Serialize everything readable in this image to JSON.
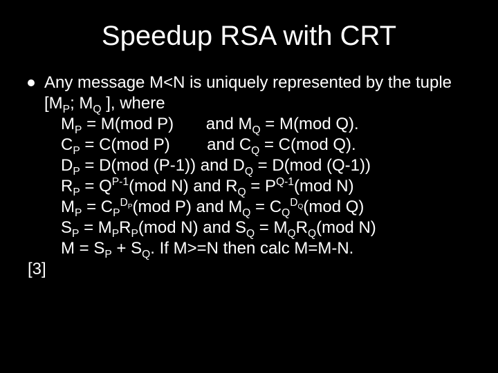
{
  "title": "Speedup RSA with CRT",
  "intro": "Any message M<N is uniquely represented by the tuple [M",
  "intro_sub1": "P",
  "intro_mid": "; M",
  "intro_sub2": "Q",
  "intro_end": " ], where",
  "lines": {
    "l1a": "M",
    "l1a_sub": "P",
    "l1b": " = M(mod P)",
    "l1_and": "and M",
    "l1c_sub": "Q",
    "l1d": " = M(mod Q).",
    "l2a": "C",
    "l2a_sub": "P",
    "l2b": " = C(mod P)",
    "l2_and": "and C",
    "l2c_sub": "Q",
    "l2d": " = C(mod Q).",
    "l3a": "D",
    "l3a_sub": "P",
    "l3b": " = D(mod (P-1))  and D",
    "l3c_sub": "Q",
    "l3d": " = D(mod (Q-1))",
    "l4a": "R",
    "l4a_sub": "P",
    "l4b": " = Q",
    "l4b_sup": "P-1",
    "l4c": "(mod N)   and R",
    "l4c_sub": "Q",
    "l4d": " = P",
    "l4d_sup": "Q-1",
    "l4e": "(mod N)",
    "l5a": "M",
    "l5a_sub": "P",
    "l5b": " = C",
    "l5b_sub": "P",
    "l5b_sup": "D",
    "l5b_sup_sub": "P",
    "l5c": "(mod P)  and M",
    "l5c_sub": "Q",
    "l5d": " = C",
    "l5d_sub": "Q",
    "l5d_sup": "D",
    "l5d_sup_sub": "Q",
    "l5e": "(mod Q)",
    "l6a": "S",
    "l6a_sub": "P",
    "l6b": " = M",
    "l6b_sub": "P",
    "l6c": "R",
    "l6c_sub": "P",
    "l6d": "(mod N) and S",
    "l6d_sub": "Q",
    "l6e": " = M",
    "l6e_sub": "Q",
    "l6f": "R",
    "l6f_sub": "Q",
    "l6g": "(mod N)",
    "l7": "M = S",
    "l7a_sub": "P",
    "l7b": " + S",
    "l7b_sub": "Q",
    "l7c": ". If M>=N then calc M=M-N."
  },
  "ref": "[3]"
}
